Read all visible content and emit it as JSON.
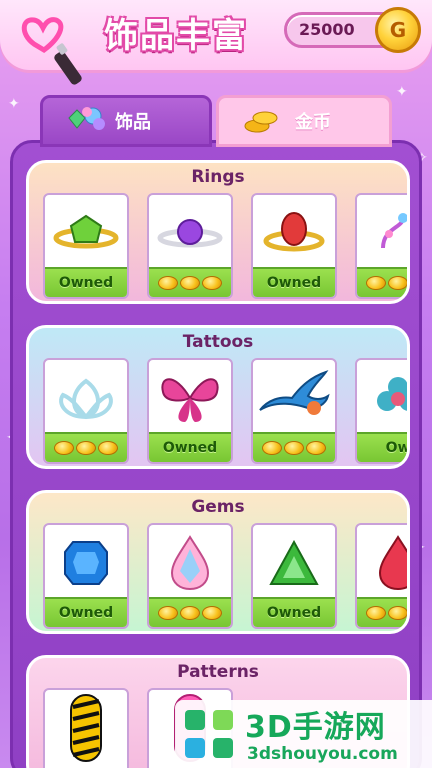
{
  "header": {
    "title": "饰品丰富",
    "coin_balance": "25000",
    "coin_symbol": "G"
  },
  "tabs": [
    {
      "label": "饰品",
      "selected": true
    },
    {
      "label": "金币",
      "selected": false
    }
  ],
  "sections": [
    {
      "title": "Rings",
      "items": [
        {
          "name": "green-gem-ring",
          "status": "Owned"
        },
        {
          "name": "purple-gem-ring",
          "status": "coins"
        },
        {
          "name": "red-gem-ring",
          "status": "Owned"
        },
        {
          "name": "swirl-ring",
          "status": "coins"
        }
      ]
    },
    {
      "title": "Tattoos",
      "items": [
        {
          "name": "lotus-tattoo",
          "status": "coins"
        },
        {
          "name": "butterfly-tattoo",
          "status": "Owned"
        },
        {
          "name": "swallow-tattoo",
          "status": "coins"
        },
        {
          "name": "flower-tattoo",
          "status": "Ow"
        }
      ]
    },
    {
      "title": "Gems",
      "items": [
        {
          "name": "blue-cushion-gem",
          "status": "Owned"
        },
        {
          "name": "rainbow-drop-gem",
          "status": "coins"
        },
        {
          "name": "green-triangle-gem",
          "status": "Owned"
        },
        {
          "name": "red-drop-gem",
          "status": "coins"
        }
      ]
    },
    {
      "title": "Patterns",
      "items": [
        {
          "name": "zebra-pattern",
          "status": ""
        },
        {
          "name": "pink-pattern",
          "status": ""
        }
      ]
    }
  ],
  "watermark": {
    "title": "3D手游网",
    "url": "3dshouyou.com"
  },
  "colors": {
    "accent_pink": "#e24aa8",
    "owned_green": "#78c633",
    "panel_purple": "#9a47c6",
    "coin_gold": "#f8c21d"
  }
}
